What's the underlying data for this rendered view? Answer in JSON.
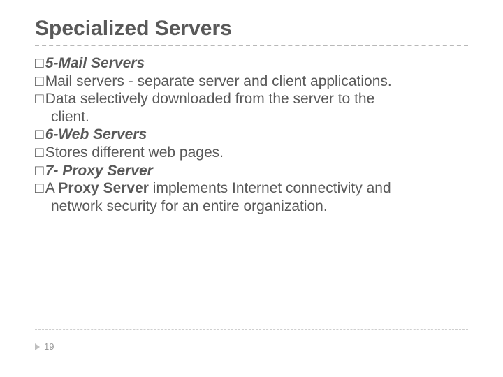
{
  "title": "Specialized Servers",
  "bullet_glyph": "□",
  "lines": [
    {
      "lead_bi": "5-Mail Servers",
      "rest": ""
    },
    {
      "lead_norm": "Mail",
      "rest": " servers - separate server and client applications."
    },
    {
      "lead_norm": "Data",
      "rest": " selectively downloaded from the server to the "
    },
    {
      "cont": "client."
    },
    {
      "lead_bi": "6-Web Servers",
      "rest": ""
    },
    {
      "lead_norm": "Stores",
      "rest": " different web pages."
    },
    {
      "lead_bi": "7-",
      "rest_bi": " Proxy Server"
    },
    {
      "lead_norm": "A ",
      "bold": "Proxy Server",
      "rest": " implements Internet connectivity and "
    },
    {
      "cont": "network security for an entire organization."
    }
  ],
  "page_number": "19"
}
